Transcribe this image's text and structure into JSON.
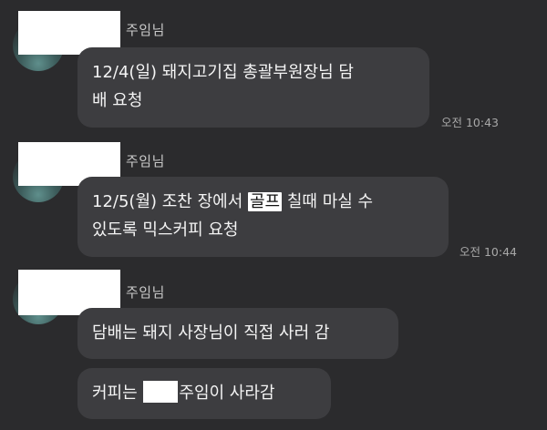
{
  "messages": [
    {
      "sender_suffix": "주임님",
      "bubbles": [
        {
          "lines": [
            "12/4(일) 돼지고기집 총괄부원장님 담",
            "배 요청"
          ]
        }
      ],
      "time": "오전 10:43"
    },
    {
      "sender_suffix": "주임님",
      "bubbles": [
        {
          "line1_before": "12/5(월) 조찬 장에서 ",
          "line1_highlight": "골프",
          "line1_after": " 칠때 마실 수",
          "line2": "있도록 믹스커피 요청"
        }
      ],
      "time": "오전 10:44"
    },
    {
      "sender_suffix": "주임님",
      "bubbles": [
        {
          "lines": [
            "담배는 돼지 사장님이 직접 사러 감"
          ]
        },
        {
          "before_redaction": "커피는 ",
          "after_redaction": "주임이 사라감"
        }
      ]
    }
  ]
}
